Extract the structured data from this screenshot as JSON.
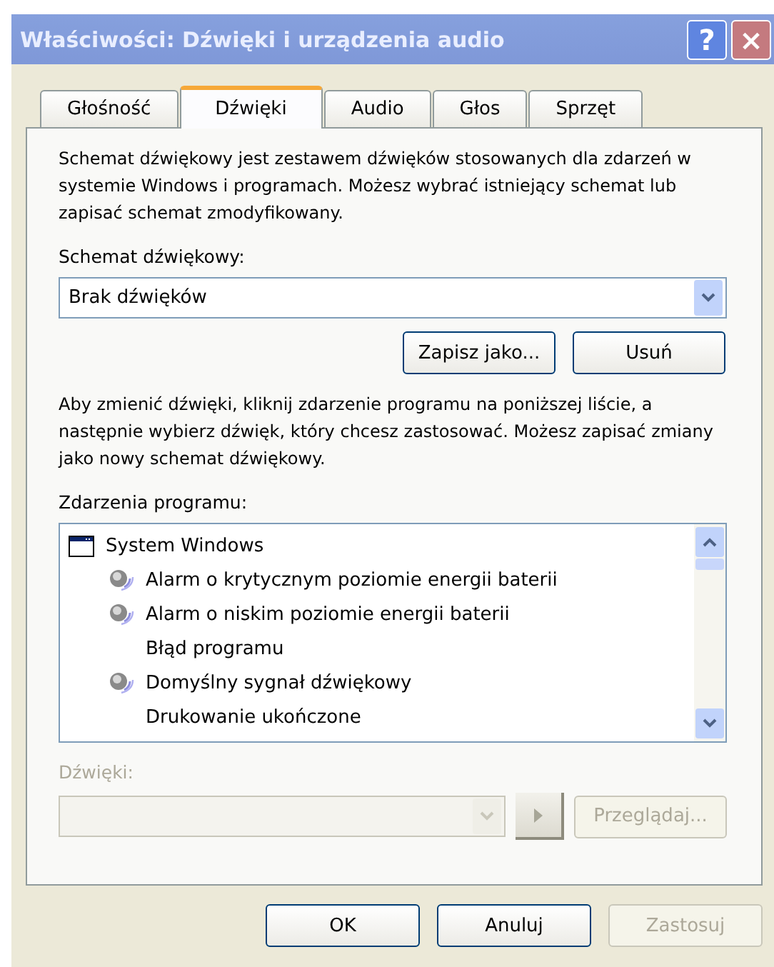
{
  "window": {
    "title": "Właściwości: Dźwięki i urządzenia audio",
    "help_button": "?",
    "close_button": "×"
  },
  "tabs": [
    {
      "label": "Głośność",
      "selected": false
    },
    {
      "label": "Dźwięki",
      "selected": true
    },
    {
      "label": "Audio",
      "selected": false
    },
    {
      "label": "Głos",
      "selected": false
    },
    {
      "label": "Sprzęt",
      "selected": false
    }
  ],
  "intro": "Schemat dźwiękowy jest zestawem dźwięków stosowanych dla zdarzeń w systemie Windows i programach. Możesz wybrać istniejący schemat lub zapisać schemat zmodyfikowany.",
  "scheme": {
    "label": "Schemat dźwiękowy:",
    "value": "Brak dźwięków",
    "buttons": [
      {
        "label": "Zapisz jako...",
        "disabled": false
      },
      {
        "label": "Usuń",
        "disabled": false
      }
    ]
  },
  "instructions": "Aby zmienić dźwięki, kliknij zdarzenie programu na poniższej liście, a następnie wybierz dźwięk, który chcesz zastosować. Możesz zapisać zmiany jako nowy schemat dźwiękowy.",
  "events": {
    "label": "Zdarzenia programu:",
    "items": [
      {
        "label": "System Windows",
        "children": [
          {
            "label": "Alarm o krytycznym poziomie energii baterii",
            "has_sound": true
          },
          {
            "label": "Alarm o niskim poziomie energii baterii",
            "has_sound": true
          },
          {
            "label": "Błąd programu",
            "has_sound": false
          },
          {
            "label": "Domyślny sygnał dźwiękowy",
            "has_sound": true
          },
          {
            "label": "Drukowanie ukończone",
            "has_sound": false
          }
        ]
      }
    ]
  },
  "sounds": {
    "label": "Dźwięki:",
    "disabled": true,
    "browse_button": {
      "label": "Przeglądaj...",
      "disabled": true
    }
  },
  "buttons": [
    {
      "label": "OK",
      "disabled": false
    },
    {
      "label": "Anuluj",
      "disabled": false
    },
    {
      "label": "Zastosuj",
      "disabled": true
    }
  ]
}
